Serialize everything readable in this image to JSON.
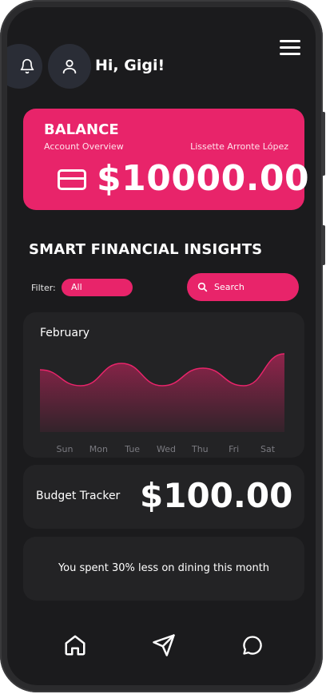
{
  "header": {
    "greeting": "Hi, Gigi!",
    "bell_icon": "bell-icon",
    "user_icon": "user-icon",
    "menu_icon": "hamburger-menu-icon"
  },
  "balance": {
    "title": "BALANCE",
    "subtitle": "Account Overview",
    "holder": "Lissette Arronte López",
    "amount": "$10000.00",
    "icon": "credit-card-icon",
    "color": "#e8246a"
  },
  "insights": {
    "title": "SMART FINANCIAL INSIGHTS",
    "filter_label": "Filter:",
    "filter_value": "All",
    "search_placeholder": "Search",
    "search_icon": "search-icon"
  },
  "chart_data": {
    "type": "area",
    "title": "February",
    "categories": [
      "Sun",
      "Mon",
      "Tue",
      "Wed",
      "Thu",
      "Fri",
      "Sat"
    ],
    "series": [
      {
        "values": [
          0.78,
          0.58,
          0.86,
          0.58,
          0.8,
          0.58,
          0.98
        ]
      }
    ],
    "ylim": [
      0,
      1
    ],
    "grid": false,
    "color": "#e8246a"
  },
  "budget": {
    "label": "Budget Tracker",
    "amount": "$100.00"
  },
  "tip": {
    "text": "You spent 30% less on dining this month"
  },
  "nav": {
    "items": [
      "home-icon",
      "send-icon",
      "chat-icon"
    ]
  }
}
